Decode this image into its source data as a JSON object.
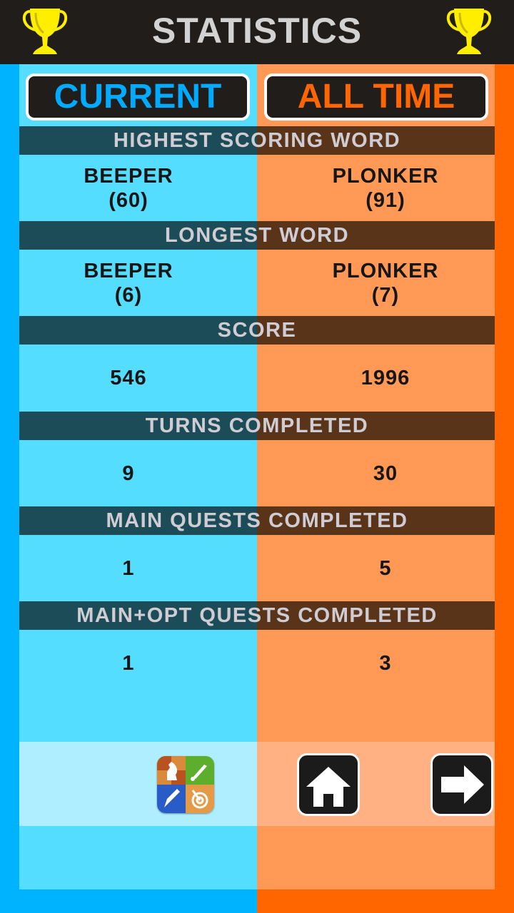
{
  "header": {
    "title": "STATISTICS",
    "left_icon": "trophy-icon",
    "right_icon": "trophy-icon"
  },
  "tabs": {
    "current": "CURRENT",
    "all_time": "ALL TIME"
  },
  "colors": {
    "current_accent": "#00aaff",
    "all_time_accent": "#ff6600",
    "trophy": "#ffee00"
  },
  "stats": [
    {
      "label": "HIGHEST SCORING WORD",
      "current": [
        "BEEPER",
        "(60)"
      ],
      "all_time": [
        "PLONKER",
        "(91)"
      ]
    },
    {
      "label": "LONGEST WORD",
      "current": [
        "BEEPER",
        "(6)"
      ],
      "all_time": [
        "PLONKER",
        "(7)"
      ]
    },
    {
      "label": "SCORE",
      "current": [
        "546"
      ],
      "all_time": [
        "1996"
      ]
    },
    {
      "label": "TURNS COMPLETED",
      "current": [
        "9"
      ],
      "all_time": [
        "30"
      ]
    },
    {
      "label": "MAIN QUESTS COMPLETED",
      "current": [
        "1"
      ],
      "all_time": [
        "5"
      ]
    },
    {
      "label": "MAIN+OPT QUESTS COMPLETED",
      "current": [
        "1"
      ],
      "all_time": [
        "3"
      ]
    }
  ],
  "footer": {
    "game_center_icon": "game-center-icon",
    "home_icon": "home-icon",
    "next_icon": "arrow-right-icon"
  }
}
